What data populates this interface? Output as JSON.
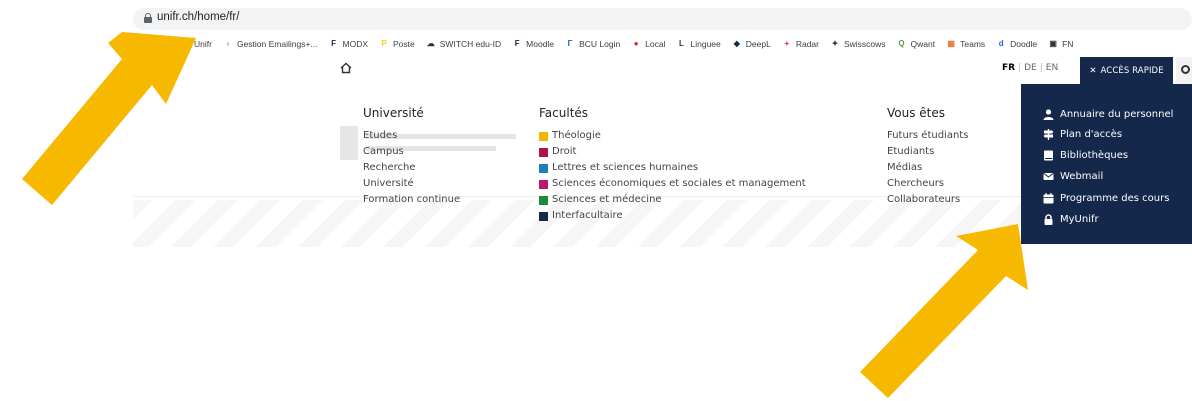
{
  "browser": {
    "url": "unifr.ch/home/fr/",
    "bookmarks": [
      {
        "label": "Unifr",
        "icon": "unifr-icon",
        "color": "#14284b",
        "glyph": "F"
      },
      {
        "label": "Gestion Emailings+...",
        "icon": "chevron-right-icon",
        "color": "#e8772e",
        "glyph": "›"
      },
      {
        "label": "MODX",
        "icon": "unifr-icon",
        "color": "#14284b",
        "glyph": "F"
      },
      {
        "label": "Poste",
        "icon": "post-icon",
        "color": "#f7d117",
        "glyph": "P"
      },
      {
        "label": "SWITCH edu-ID",
        "icon": "cloud-icon",
        "color": "#333333",
        "glyph": "☁"
      },
      {
        "label": "Moodle",
        "icon": "unifr-icon",
        "color": "#14284b",
        "glyph": "F"
      },
      {
        "label": "BCU Login",
        "icon": "bcu-icon",
        "color": "#1a5fb4",
        "glyph": "Γ"
      },
      {
        "label": "Local",
        "icon": "local-icon",
        "color": "#d9222a",
        "glyph": "●"
      },
      {
        "label": "Linguee",
        "icon": "linguee-icon",
        "color": "#2e3b55",
        "glyph": "L"
      },
      {
        "label": "DeepL",
        "icon": "deepl-icon",
        "color": "#0f2b46",
        "glyph": "◆"
      },
      {
        "label": "Radar",
        "icon": "swiss-cross-icon",
        "color": "#d9222a",
        "glyph": "+"
      },
      {
        "label": "Swisscows",
        "icon": "swisscows-icon",
        "color": "#2d3436",
        "glyph": "✦"
      },
      {
        "label": "Qwant",
        "icon": "qwant-icon",
        "color": "#5a9e3b",
        "glyph": "Q"
      },
      {
        "label": "Teams",
        "icon": "grid-icon",
        "color": "#e8772e",
        "glyph": "▦"
      },
      {
        "label": "Doodle",
        "icon": "doodle-icon",
        "color": "#1e63d6",
        "glyph": "d"
      },
      {
        "label": "FN",
        "icon": "fn-icon",
        "color": "#333333",
        "glyph": "▣"
      }
    ]
  },
  "header": {
    "lang_active": "FR",
    "lang_de": "DE",
    "lang_en": "EN",
    "acces_rapide": "ACCÈS RAPIDE"
  },
  "menu": {
    "universite": {
      "title": "Université",
      "items": [
        "Etudes",
        "Campus",
        "Recherche",
        "Université",
        "Formation continue"
      ]
    },
    "facultes": {
      "title": "Facultés",
      "items": [
        {
          "label": "Théologie",
          "color": "#f2b600"
        },
        {
          "label": "Droit",
          "color": "#b0124a"
        },
        {
          "label": "Lettres et sciences humaines",
          "color": "#1f80b8"
        },
        {
          "label": "Sciences économiques et sociales et management",
          "color": "#b8176b"
        },
        {
          "label": "Sciences et médecine",
          "color": "#1b8a3c"
        },
        {
          "label": "Interfacultaire",
          "color": "#14284b"
        }
      ]
    },
    "vous_etes": {
      "title": "Vous êtes",
      "items": [
        "Futurs étudiants",
        "Etudiants",
        "Médias",
        "Chercheurs",
        "Collaborateurs"
      ]
    }
  },
  "quick_access": {
    "items": [
      {
        "label": "Annuaire du personnel",
        "icon": "user-icon"
      },
      {
        "label": "Plan d'accès",
        "icon": "signpost-icon"
      },
      {
        "label": "Bibliothèques",
        "icon": "book-icon"
      },
      {
        "label": "Webmail",
        "icon": "envelope-icon"
      },
      {
        "label": "Programme des cours",
        "icon": "calendar-icon"
      },
      {
        "label": "MyUnifr",
        "icon": "lock-icon"
      }
    ]
  },
  "colors": {
    "navy": "#14284b",
    "arrow": "#f7b800"
  }
}
